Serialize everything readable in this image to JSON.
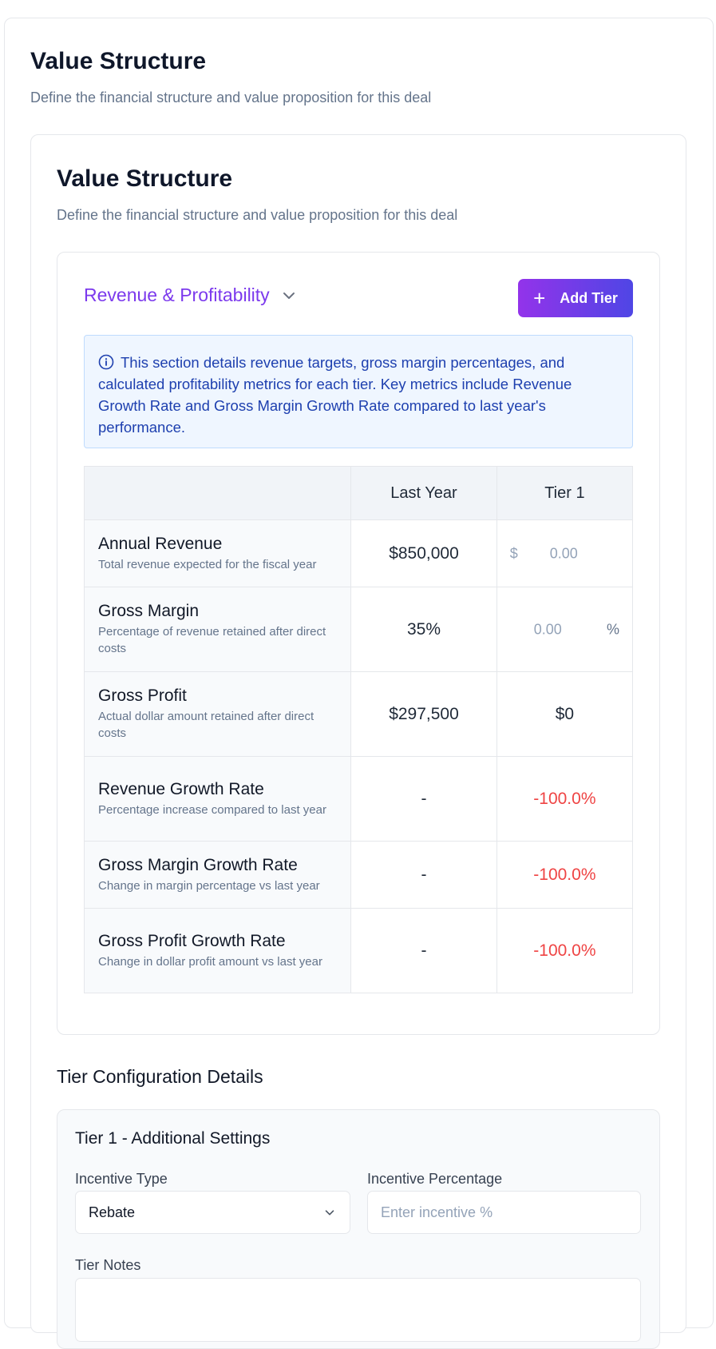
{
  "page": {
    "title": "Value Structure",
    "subtitle": "Define the financial structure and value proposition for this deal"
  },
  "inner": {
    "title": "Value Structure",
    "subtitle": "Define the financial structure and value proposition for this deal"
  },
  "section": {
    "label": "Revenue & Profitability",
    "add_tier_label": "Add Tier",
    "info_text": "This section details revenue targets, gross margin percentages, and calculated profitability metrics for each tier. Key metrics include Revenue Growth Rate and Gross Margin Growth Rate compared to last year's performance.",
    "accent_color": "#7c3aed"
  },
  "table": {
    "columns": [
      "",
      "Last Year",
      "Tier 1"
    ],
    "rows": [
      {
        "title": "Annual Revenue",
        "desc": "Total revenue expected for the fiscal year",
        "last_year": "$850,000",
        "tier_prefix": "$",
        "tier_placeholder": "0.00"
      },
      {
        "title": "Gross Margin",
        "desc": "Percentage of revenue retained after direct costs",
        "last_year": "35%",
        "tier_placeholder": "0.00",
        "tier_suffix": "%"
      },
      {
        "title": "Gross Profit",
        "desc": "Actual dollar amount retained after direct costs",
        "last_year": "$297,500",
        "tier": "$0"
      },
      {
        "title": "Revenue Growth Rate",
        "desc": "Percentage increase compared to last year",
        "last_year": "-",
        "tier": "-100.0%"
      },
      {
        "title": "Gross Margin Growth Rate",
        "desc": "Change in margin percentage vs last year",
        "last_year": "-",
        "tier": "-100.0%"
      },
      {
        "title": "Gross Profit Growth Rate",
        "desc": "Change in dollar profit amount vs last year",
        "last_year": "-",
        "tier": "-100.0%"
      }
    ],
    "negative_color": "#ef4444"
  },
  "tier_config": {
    "title": "Tier Configuration Details",
    "panel_title": "Tier 1 - Additional Settings",
    "incentive_type_label": "Incentive Type",
    "incentive_type_value": "Rebate",
    "incentive_pct_label": "Incentive Percentage",
    "incentive_pct_placeholder": "Enter incentive %",
    "notes_label": "Tier Notes"
  }
}
